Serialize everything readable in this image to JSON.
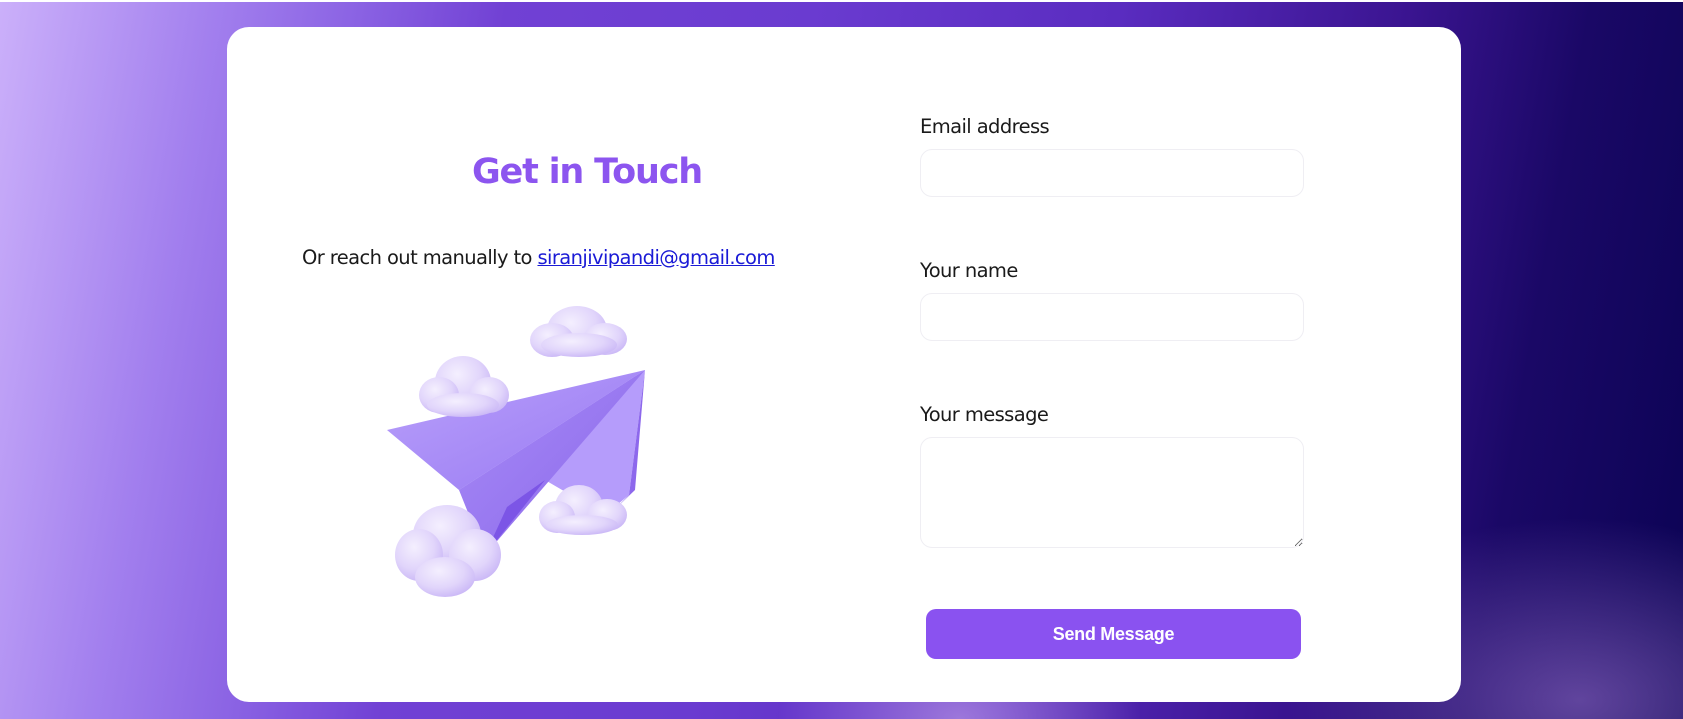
{
  "contact": {
    "title": "Get in Touch",
    "reach_text": "Or reach out manually to ",
    "email_link": "siranjivipandi@gmail.com"
  },
  "illustration": {
    "icon": "paper-plane-with-clouds",
    "colors": {
      "plane": "#9d7bf5",
      "plane_dark": "#7c55e6",
      "cloud": "#e2d6fb"
    }
  },
  "form": {
    "email_label": "Email address",
    "email_value": "",
    "name_label": "Your name",
    "name_value": "",
    "message_label": "Your message",
    "message_value": "",
    "submit_label": "Send Message"
  },
  "theme": {
    "accent": "#8a52f0",
    "title_color": "#8c55ef",
    "link_color": "#1a1ad6",
    "background_gradient": [
      "#cbb0fa",
      "#6a3bd0",
      "#0b0354"
    ]
  }
}
